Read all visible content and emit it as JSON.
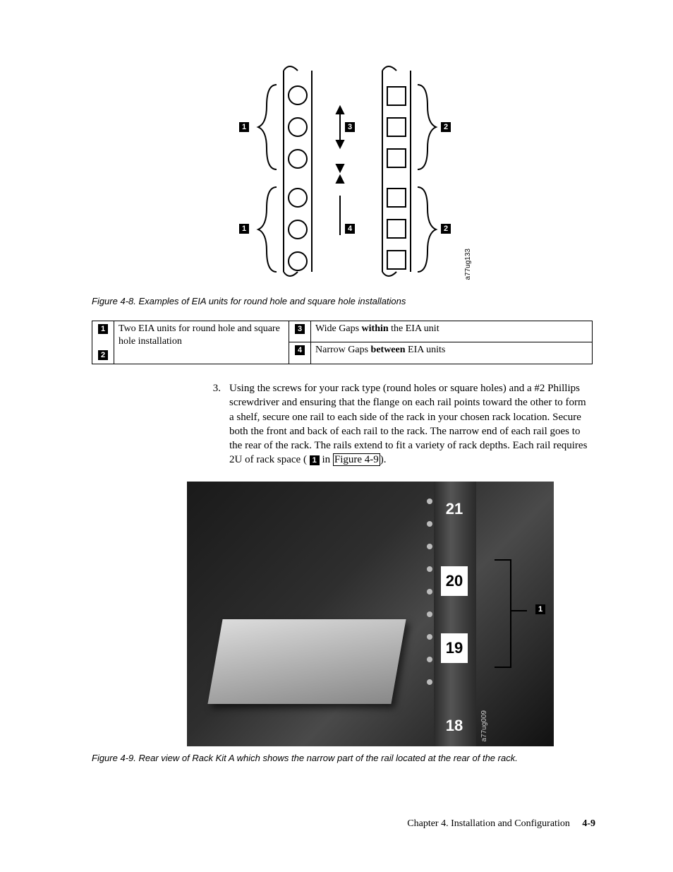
{
  "figure48": {
    "caption": "Figure 4-8. Examples of EIA units for round hole and square hole installations",
    "sidelabel": "a77ug133",
    "callouts": {
      "c1": "1",
      "c2": "2",
      "c3": "3",
      "c4": "4"
    }
  },
  "legend": {
    "left_num_top": "1",
    "left_num_bot": "2",
    "left_text": "Two EIA units for round hole and square hole installation",
    "right_top_num": "3",
    "right_top_text_a": "Wide Gaps ",
    "right_top_text_bold": "within",
    "right_top_text_b": " the EIA unit",
    "right_bot_num": "4",
    "right_bot_text_a": "Narrow Gaps ",
    "right_bot_text_bold": "between",
    "right_bot_text_b": " EIA units"
  },
  "step3": {
    "num": "3.",
    "text_a": "Using the screws for your rack type (round holes or square holes) and a #2 Phillips screwdriver and ensuring that the flange on each rail points toward the other to form a shelf, secure one rail to each side of the rack in your chosen rack location. Secure both the front and back of each rail to the rack. The narrow end of each rail goes to the rear of the rack. The rails extend to fit a variety of rack depths. Each rail requires 2U of rack space ( ",
    "callnum": "1",
    "text_b": "  in ",
    "figref": "Figure 4-9",
    "text_c": ")."
  },
  "figure49": {
    "labels": {
      "l21": "21",
      "l20": "20",
      "l19": "19",
      "l18": "18"
    },
    "callout1": "1",
    "sidelabel": "a77ug009",
    "caption": "Figure 4-9. Rear view of Rack Kit A which shows the narrow part of the rail located at the rear of the rack."
  },
  "footer": {
    "chapter": "Chapter 4. Installation and Configuration",
    "page": "4-9"
  }
}
